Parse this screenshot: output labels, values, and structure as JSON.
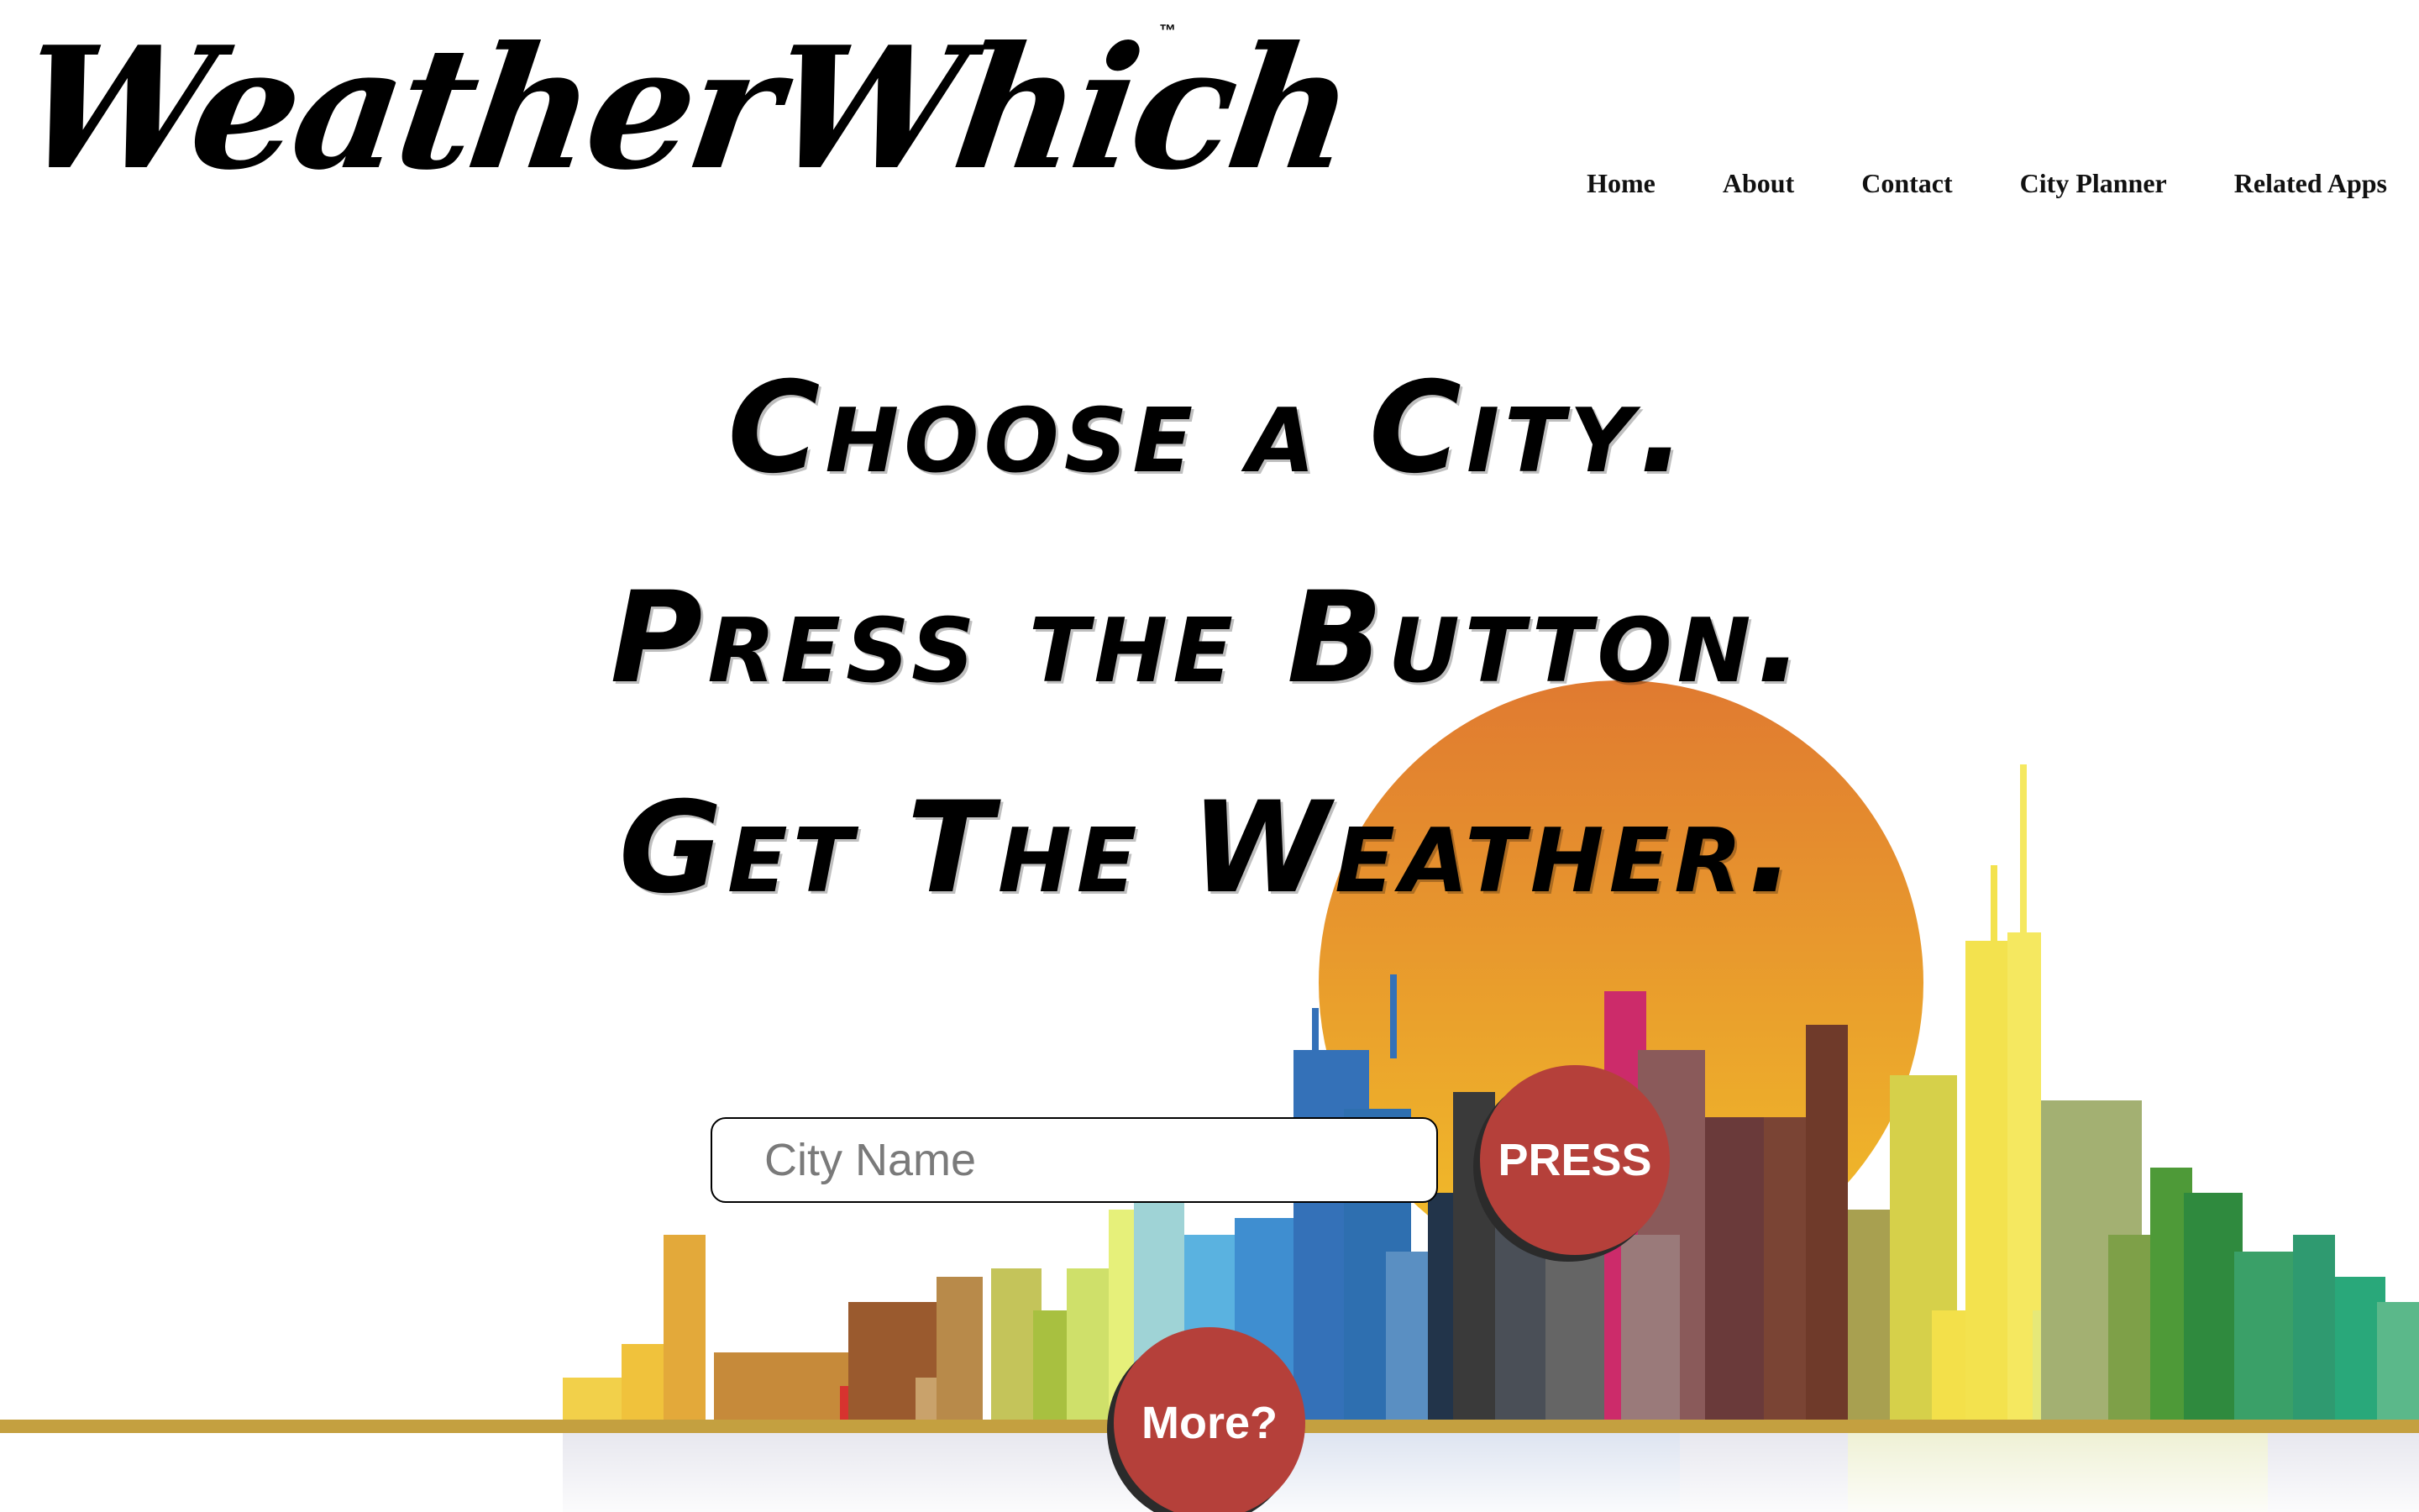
{
  "header": {
    "logo_text": "WeatherWhich",
    "trademark": "™"
  },
  "nav": {
    "items": [
      "Home",
      "About",
      "Contact",
      "City Planner",
      "Related Apps"
    ]
  },
  "hero": {
    "line1": "Choose a City.",
    "line2": "Press the Button.",
    "line3": "Get The Weather."
  },
  "search": {
    "placeholder": "City Name",
    "value": ""
  },
  "buttons": {
    "press_label": "PRESS",
    "more_label": "More?"
  },
  "colors": {
    "accent_button": "#b5403a",
    "sun_top": "#e07a30",
    "sun_bottom": "#f2c029"
  }
}
